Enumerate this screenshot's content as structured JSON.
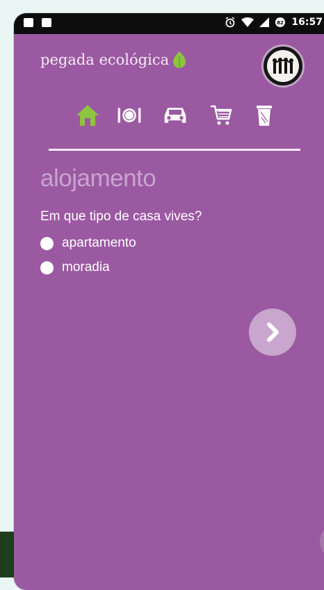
{
  "statusbar": {
    "time": "16:57",
    "icons": [
      "camera-icon",
      "image-icon",
      "alarm-icon",
      "wifi-icon",
      "signal-icon",
      "battery-icon"
    ]
  },
  "app": {
    "brand": "pegada ecológica",
    "brand_icon": "leaf-icon",
    "avatar_icon": "group-avatar-icon"
  },
  "nav": {
    "items": [
      {
        "name": "home",
        "icon": "house-icon",
        "active": true
      },
      {
        "name": "food",
        "icon": "plate-cutlery-icon",
        "active": false
      },
      {
        "name": "transport",
        "icon": "car-icon",
        "active": false
      },
      {
        "name": "shopping",
        "icon": "cart-icon",
        "active": false
      },
      {
        "name": "waste",
        "icon": "trash-icon",
        "active": false
      }
    ],
    "active_color": "#8cc63f",
    "inactive_color": "#ffffff"
  },
  "section": {
    "title": "alojamento"
  },
  "question": {
    "text": "Em que tipo de casa vives?"
  },
  "options": [
    {
      "label": "apartamento"
    },
    {
      "label": "moradia"
    }
  ],
  "colors": {
    "background": "#9b59a2",
    "accent_green": "#8cc63f",
    "title": "#c9a4cf"
  }
}
